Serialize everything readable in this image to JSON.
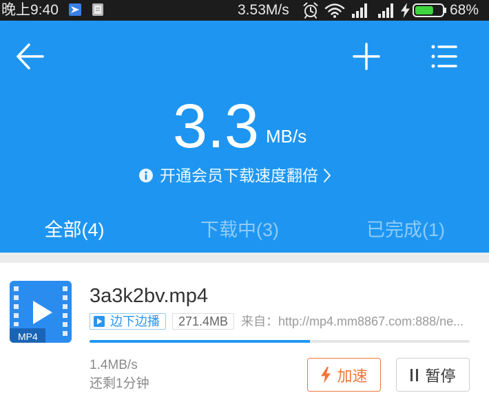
{
  "status_bar": {
    "time": "晚上9:40",
    "network_speed": "3.53M/s",
    "battery_text": "68%",
    "battery_level": 0.68,
    "icons": {
      "app_1": "app-notification-icon",
      "app_2": "notification-icon",
      "alarm": "alarm-clock-icon",
      "wifi": "wifi-icon",
      "signal_1": "cellular-signal-icon",
      "signal_2": "cellular-signal-icon",
      "charging": "charging-bolt-icon",
      "battery": "battery-icon"
    }
  },
  "toolbar": {
    "icons": {
      "back": "back-arrow-icon",
      "add": "plus-icon",
      "menu": "list-menu-icon"
    }
  },
  "speed_panel": {
    "value": "3.3",
    "unit": "MB/s",
    "promo_text": "开通会员下载速度翻倍",
    "icons": {
      "info": "info-icon",
      "chevron": "chevron-right-icon"
    }
  },
  "tabs": [
    {
      "label": "全部(4)",
      "active": true
    },
    {
      "label": "下载中(3)",
      "active": false
    },
    {
      "label": "已完成(1)",
      "active": false
    }
  ],
  "downloads": [
    {
      "file_type_label": "MP4",
      "filename": "3a3k2bv.mp4",
      "play_while_download_label": "边下边播",
      "size": "271.4MB",
      "source": "来自：http://mp4.mm8867.com:888/ne...",
      "progress": 0.58,
      "speed": "1.4MB/s",
      "time_remaining": "还剩1分钟",
      "accelerate_label": "加速",
      "pause_label": "暂停",
      "icons": {
        "file": "mp4-video-file-icon",
        "play_tag": "play-icon",
        "accelerate": "lightning-bolt-icon",
        "pause": "pause-icon"
      }
    }
  ],
  "colors": {
    "status_bar_bg": "#1c1c1c",
    "header_blue": "#1e96f1",
    "separator_gray": "#ececec",
    "progress_blue": "#2196f3",
    "progress_track": "#e6e6e6",
    "tag_blue": "#2b95ee",
    "tag_border": "#93ccf6",
    "accent_orange": "#f0763a",
    "battery_green": "#3fd53f",
    "file_icon_blue": "#2b8cf0",
    "file_icon_dark": "#1a64b6"
  }
}
